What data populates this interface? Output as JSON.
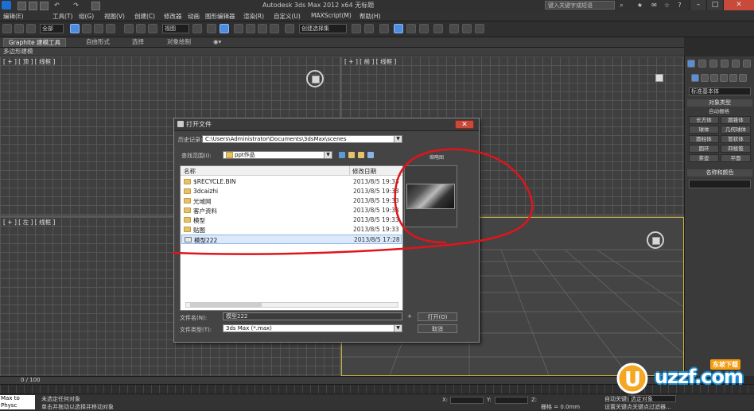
{
  "window": {
    "title": "Autodesk 3ds Max  2012 x64     无标题",
    "search_placeholder": "键入关键字或短语"
  },
  "menus": [
    "编辑(E)",
    "工具(T)",
    "组(G)",
    "视图(V)",
    "创建(C)",
    "修改器",
    "动画",
    "图形编辑器",
    "渲染(R)",
    "自定义(U)",
    "MAXScript(M)",
    "帮助(H)"
  ],
  "toolbar": {
    "selection_filter": "全部",
    "reference_coord": "视图",
    "named_selection": "创建选择集"
  },
  "ribbon": {
    "tabs": [
      "Graphite 建模工具",
      "自由形式",
      "选择",
      "对象绘制"
    ],
    "sub_label": "多边形建模"
  },
  "viewports": {
    "top_left_label": "[ + ] [ 顶 ] [ 线框 ]",
    "top_right_label": "[ + ] [ 前 ] [ 线框 ]",
    "bottom_left_label": "[ + ] [ 左 ] [ 线框 ]"
  },
  "command_panel": {
    "category": "标准基本体",
    "rollout_object_type": "对象类型",
    "autogrid": "自动栅格",
    "buttons": [
      "长方体",
      "圆锥体",
      "球体",
      "几何球体",
      "圆柱体",
      "管状体",
      "圆环",
      "四棱锥",
      "茶壶",
      "平面"
    ],
    "rollout_name_color": "名称和颜色"
  },
  "timeline": {
    "frames": "0 / 100"
  },
  "status": {
    "maxscript_text": "Max to Physc",
    "line1": "未选定任何对象",
    "line2": "单击并拖动以选择并移动对象",
    "x_label": "X:",
    "y_label": "Y:",
    "z_label": "Z:",
    "grid": "栅格 = 0.0mm",
    "auto_key": "自动关键点",
    "selected": "选定对象",
    "set_key": "设置关键点",
    "key_filter": "关键点过滤器..."
  },
  "dialog": {
    "title": "打开文件",
    "history_label": "历史记录:",
    "history_value": "C:\\Users\\Administrator\\Documents\\3dsMax\\scenes",
    "lookin_label": "查找范围(I):",
    "lookin_value": "ppt作品",
    "columns": {
      "name": "名称",
      "modified": "修改日期"
    },
    "files": [
      {
        "name": "$RECYCLE.BIN",
        "date": "2013/8/5 19:33",
        "type": "folder"
      },
      {
        "name": "3dcaizhi",
        "date": "2013/8/5 19:33",
        "type": "folder"
      },
      {
        "name": "光域网",
        "date": "2013/8/5 19:33",
        "type": "folder"
      },
      {
        "name": "客户资料",
        "date": "2013/8/5 19:33",
        "type": "folder"
      },
      {
        "name": "模型",
        "date": "2013/8/5 19:33",
        "type": "folder"
      },
      {
        "name": "贴图",
        "date": "2013/8/5 19:33",
        "type": "folder"
      },
      {
        "name": "模型222",
        "date": "2013/8/5 17:28",
        "type": "max",
        "selected": true
      }
    ],
    "thumbnail_label": "缩略图",
    "filename_label": "文件名(N):",
    "filename_value": "模型222",
    "filetype_label": "文件类型(T):",
    "filetype_value": "3ds Max (*.max)",
    "open_button": "打开(O)",
    "cancel_button": "取消",
    "plus_button": "+"
  },
  "watermark": {
    "text": "uzzf.com",
    "tag": "东坡下载"
  },
  "colors": {
    "highlight": "#4f8ddc",
    "annotation": "#e0141c",
    "selection_row": "#dbe9fb"
  }
}
